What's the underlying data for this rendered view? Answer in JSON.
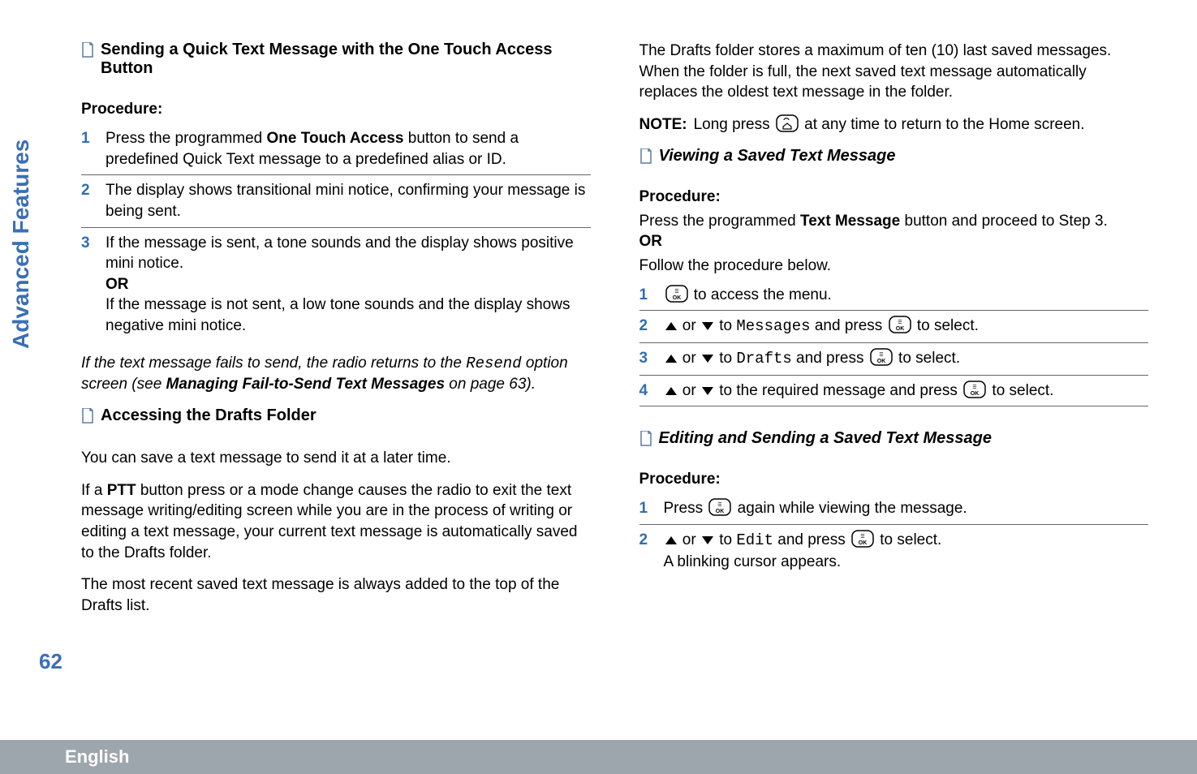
{
  "sideLabel": "Advanced Features",
  "pageNumber": "62",
  "footer": "English",
  "left": {
    "h1": "Sending a Quick Text Message with the One Touch Access Button",
    "procLabel": "Procedure:",
    "steps": [
      {
        "num": "1",
        "pre": "Press the programmed ",
        "bold": "One Touch Access",
        "post": " button to send a predefined Quick Text message to a predefined alias or ID."
      },
      {
        "num": "2",
        "text": "The display shows transitional mini notice, confirming your message is being sent."
      },
      {
        "num": "3",
        "text": "If the message is sent, a tone sounds and the display shows positive mini notice.",
        "or": "OR",
        "text2": "If the message is not sent, a low tone sounds and the display shows negative mini notice."
      }
    ],
    "italicPara": {
      "pre": "If the text message fails to send, the radio returns to the ",
      "mono": "Resend",
      "mid": " option screen (see ",
      "boldItalic": "Managing Fail-to-Send Text Messages",
      "post": " on page 63)."
    },
    "h2": "Accessing the Drafts Folder",
    "p1": "You can save a text message to send it at a later time.",
    "p2pre": "If a ",
    "p2bold": "PTT",
    "p2post": " button press or a mode change causes the radio to exit the text message writing/editing screen while you are in the process of writing or editing a text message, your current text message is automatically saved to the Drafts folder.",
    "p3": "The most recent saved text message is always added to the top of the Drafts list."
  },
  "right": {
    "p1": "The Drafts folder stores a maximum of ten (10) last saved messages. When the folder is full, the next saved text message automatically replaces the oldest text message in the folder.",
    "noteLabel": "NOTE:",
    "noteTextPre": "Long press ",
    "noteTextPost": " at any time to return to the Home screen.",
    "h1": "Viewing a Saved Text Message",
    "procLabel": "Procedure:",
    "procIntroPre": "Press the programmed ",
    "procIntroBold": "Text Message",
    "procIntroPost": " button and proceed to Step 3.",
    "or": "OR",
    "procIntro2": "Follow the procedure below.",
    "steps1": [
      {
        "num": "1",
        "post": " to access the menu."
      },
      {
        "num": "2",
        "mid1": " or ",
        "mid2": " to ",
        "mono": "Messages",
        "mid3": " and press ",
        "post": " to select."
      },
      {
        "num": "3",
        "mid1": " or ",
        "mid2": " to ",
        "mono": "Drafts",
        "mid3": " and press ",
        "post": " to select."
      },
      {
        "num": "4",
        "mid1": " or ",
        "mid2": " to the required message and press ",
        "post": " to select."
      }
    ],
    "h2": "Editing and Sending a Saved Text Message",
    "procLabel2": "Procedure:",
    "steps2": [
      {
        "num": "1",
        "pre": "Press ",
        "post": " again while viewing the message."
      },
      {
        "num": "2",
        "mid1": " or ",
        "mid2": " to ",
        "mono": "Edit",
        "mid3": " and press ",
        "post": " to select.",
        "extra": "A blinking cursor appears."
      }
    ]
  }
}
